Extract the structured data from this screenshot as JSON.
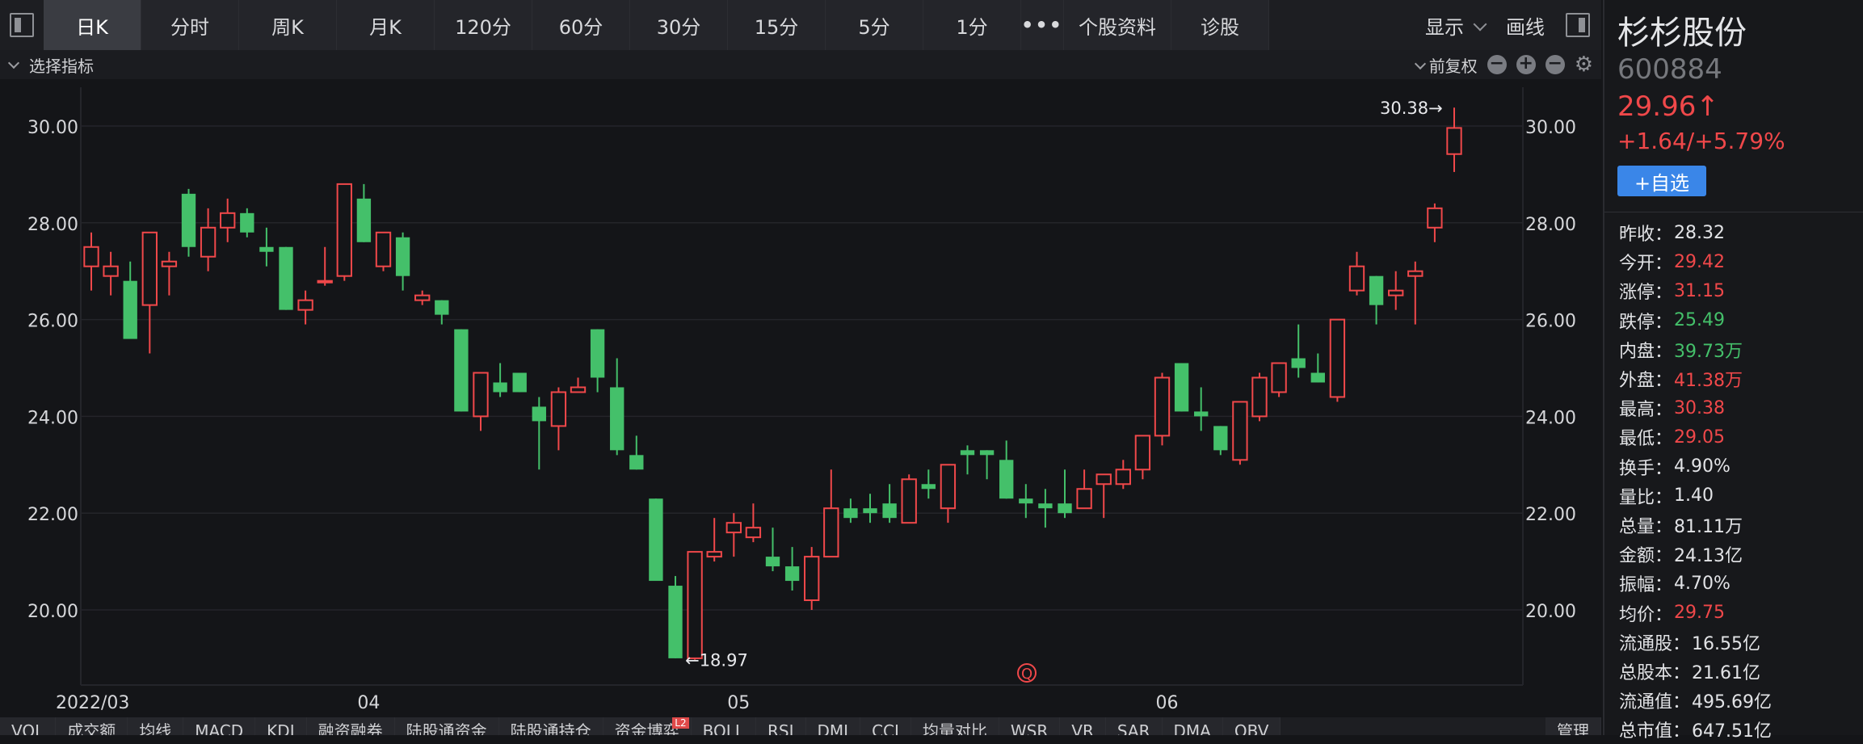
{
  "toolbar": {
    "tabs": [
      "日K",
      "分时",
      "周K",
      "月K",
      "120分",
      "60分",
      "30分",
      "15分",
      "5分",
      "1分",
      "•••",
      "个股资料",
      "诊股"
    ],
    "display_label": "显示",
    "draw_label": "画线"
  },
  "subbar": {
    "indicator_label": "选择指标",
    "adjust_label": "前复权"
  },
  "stock": {
    "name": "杉杉股份",
    "code": "600884",
    "price": "29.96↑",
    "change": "+1.64/+5.79%",
    "add_label": "+自选"
  },
  "stats": [
    {
      "k": "昨收：",
      "v": "28.32",
      "color": "#e2e3e6"
    },
    {
      "k": "今开：",
      "v": "29.42",
      "color": "#f0484a"
    },
    {
      "k": "涨停：",
      "v": "31.15",
      "color": "#f0484a"
    },
    {
      "k": "跌停：",
      "v": "25.49",
      "color": "#44c06a"
    },
    {
      "k": "内盘：",
      "v": "39.73万",
      "color": "#44c06a"
    },
    {
      "k": "外盘：",
      "v": "41.38万",
      "color": "#f0484a"
    },
    {
      "k": "最高：",
      "v": "30.38",
      "color": "#f0484a"
    },
    {
      "k": "最低：",
      "v": "29.05",
      "color": "#f0484a"
    },
    {
      "k": "换手：",
      "v": "4.90%",
      "color": "#e2e3e6"
    },
    {
      "k": "量比：",
      "v": "1.40",
      "color": "#e2e3e6"
    },
    {
      "k": "总量：",
      "v": "81.11万",
      "color": "#e2e3e6"
    },
    {
      "k": "金额：",
      "v": "24.13亿",
      "color": "#e2e3e6"
    },
    {
      "k": "振幅：",
      "v": "4.70%",
      "color": "#e2e3e6"
    },
    {
      "k": "均价：",
      "v": "29.75",
      "color": "#f0484a"
    },
    {
      "k": "流通股：",
      "v": "16.55亿",
      "color": "#e2e3e6"
    },
    {
      "k": "总股本：",
      "v": "21.61亿",
      "color": "#e2e3e6"
    },
    {
      "k": "流通值：",
      "v": "495.69亿",
      "color": "#e2e3e6"
    },
    {
      "k": "总市值：",
      "v": "647.51亿",
      "color": "#e2e3e6"
    }
  ],
  "bottom_tabs": [
    "VOL",
    "成交额",
    "均线",
    "MACD",
    "KDJ",
    "融资融券",
    "陆股通资金",
    "陆股通持仓",
    "资金博弈",
    "BOLL",
    "RSI",
    "DMI",
    "CCI",
    "均量对比",
    "WSR",
    "VR",
    "SAR",
    "DMA",
    "OBV",
    "管理"
  ],
  "bottom_badge": "L2",
  "colors": {
    "up": "#f0484a",
    "down": "#44c06a",
    "grid": "#24252a",
    "axis_text": "#d6d7da"
  },
  "chart_data": {
    "type": "candlestick",
    "x_labels": [
      "2022/03",
      "04",
      "05",
      "06"
    ],
    "y_ticks": [
      "30.00",
      "28.00",
      "26.00",
      "24.00",
      "22.00",
      "20.00"
    ],
    "ylim": [
      18.4,
      31.3
    ],
    "annotations": [
      {
        "text": "30.38→",
        "value": 30.38
      },
      {
        "text": "←18.97",
        "value": 18.97
      }
    ],
    "marker": "Q",
    "candles": [
      {
        "o": 27.1,
        "h": 27.8,
        "l": 26.6,
        "c": 27.5
      },
      {
        "o": 26.9,
        "h": 27.4,
        "l": 26.5,
        "c": 27.1
      },
      {
        "o": 26.8,
        "h": 27.2,
        "l": 25.6,
        "c": 25.6
      },
      {
        "o": 26.3,
        "h": 27.8,
        "l": 25.3,
        "c": 27.8
      },
      {
        "o": 27.1,
        "h": 27.4,
        "l": 26.5,
        "c": 27.2
      },
      {
        "o": 28.6,
        "h": 28.7,
        "l": 27.3,
        "c": 27.5
      },
      {
        "o": 27.3,
        "h": 28.3,
        "l": 27.0,
        "c": 27.9
      },
      {
        "o": 27.9,
        "h": 28.5,
        "l": 27.6,
        "c": 28.2
      },
      {
        "o": 28.2,
        "h": 28.3,
        "l": 27.7,
        "c": 27.8
      },
      {
        "o": 27.5,
        "h": 27.9,
        "l": 27.1,
        "c": 27.4
      },
      {
        "o": 27.5,
        "h": 27.5,
        "l": 26.2,
        "c": 26.2
      },
      {
        "o": 26.2,
        "h": 26.6,
        "l": 25.9,
        "c": 26.4
      },
      {
        "o": 26.8,
        "h": 27.5,
        "l": 26.7,
        "c": 26.8
      },
      {
        "o": 26.9,
        "h": 28.8,
        "l": 26.8,
        "c": 28.8
      },
      {
        "o": 28.5,
        "h": 28.8,
        "l": 27.6,
        "c": 27.6
      },
      {
        "o": 27.1,
        "h": 27.8,
        "l": 27.0,
        "c": 27.8
      },
      {
        "o": 27.7,
        "h": 27.8,
        "l": 26.6,
        "c": 26.9
      },
      {
        "o": 26.4,
        "h": 26.6,
        "l": 26.3,
        "c": 26.5
      },
      {
        "o": 26.4,
        "h": 26.4,
        "l": 25.9,
        "c": 26.1
      },
      {
        "o": 25.8,
        "h": 25.8,
        "l": 24.1,
        "c": 24.1
      },
      {
        "o": 24.0,
        "h": 24.9,
        "l": 23.7,
        "c": 24.9
      },
      {
        "o": 24.7,
        "h": 25.1,
        "l": 24.4,
        "c": 24.5
      },
      {
        "o": 24.9,
        "h": 24.9,
        "l": 24.5,
        "c": 24.5
      },
      {
        "o": 24.2,
        "h": 24.4,
        "l": 22.9,
        "c": 23.9
      },
      {
        "o": 23.8,
        "h": 24.6,
        "l": 23.3,
        "c": 24.5
      },
      {
        "o": 24.5,
        "h": 24.8,
        "l": 24.5,
        "c": 24.6
      },
      {
        "o": 25.8,
        "h": 25.8,
        "l": 24.5,
        "c": 24.8
      },
      {
        "o": 24.6,
        "h": 25.2,
        "l": 23.2,
        "c": 23.3
      },
      {
        "o": 23.2,
        "h": 23.6,
        "l": 22.9,
        "c": 22.9
      },
      {
        "o": 22.3,
        "h": 22.3,
        "l": 20.6,
        "c": 20.6
      },
      {
        "o": 20.5,
        "h": 20.7,
        "l": 19.0,
        "c": 19.0
      },
      {
        "o": 19.0,
        "h": 21.2,
        "l": 18.97,
        "c": 21.2
      },
      {
        "o": 21.1,
        "h": 21.9,
        "l": 21.0,
        "c": 21.2
      },
      {
        "o": 21.6,
        "h": 22.0,
        "l": 21.1,
        "c": 21.8
      },
      {
        "o": 21.5,
        "h": 22.2,
        "l": 21.4,
        "c": 21.7
      },
      {
        "o": 21.1,
        "h": 21.7,
        "l": 20.8,
        "c": 20.9
      },
      {
        "o": 20.9,
        "h": 21.3,
        "l": 20.4,
        "c": 20.6
      },
      {
        "o": 20.2,
        "h": 21.3,
        "l": 20.0,
        "c": 21.1
      },
      {
        "o": 21.1,
        "h": 22.9,
        "l": 21.1,
        "c": 22.1
      },
      {
        "o": 22.1,
        "h": 22.3,
        "l": 21.8,
        "c": 21.9
      },
      {
        "o": 22.1,
        "h": 22.4,
        "l": 21.8,
        "c": 22.0
      },
      {
        "o": 22.2,
        "h": 22.6,
        "l": 21.8,
        "c": 21.9
      },
      {
        "o": 21.8,
        "h": 22.8,
        "l": 21.8,
        "c": 22.7
      },
      {
        "o": 22.6,
        "h": 22.9,
        "l": 22.3,
        "c": 22.5
      },
      {
        "o": 22.1,
        "h": 23.0,
        "l": 21.8,
        "c": 23.0
      },
      {
        "o": 23.3,
        "h": 23.4,
        "l": 22.8,
        "c": 23.2
      },
      {
        "o": 23.3,
        "h": 23.3,
        "l": 22.7,
        "c": 23.2
      },
      {
        "o": 23.1,
        "h": 23.5,
        "l": 22.3,
        "c": 22.3
      },
      {
        "o": 22.3,
        "h": 22.6,
        "l": 21.9,
        "c": 22.2
      },
      {
        "o": 22.2,
        "h": 22.5,
        "l": 21.7,
        "c": 22.1
      },
      {
        "o": 22.2,
        "h": 22.9,
        "l": 21.9,
        "c": 22.0
      },
      {
        "o": 22.1,
        "h": 22.9,
        "l": 22.1,
        "c": 22.5
      },
      {
        "o": 22.6,
        "h": 22.7,
        "l": 21.9,
        "c": 22.8
      },
      {
        "o": 22.6,
        "h": 23.1,
        "l": 22.5,
        "c": 22.9
      },
      {
        "o": 22.9,
        "h": 23.6,
        "l": 22.7,
        "c": 23.6
      },
      {
        "o": 23.6,
        "h": 24.9,
        "l": 23.4,
        "c": 24.8
      },
      {
        "o": 25.1,
        "h": 25.1,
        "l": 24.1,
        "c": 24.1
      },
      {
        "o": 24.1,
        "h": 24.6,
        "l": 23.7,
        "c": 24.0
      },
      {
        "o": 23.8,
        "h": 23.8,
        "l": 23.2,
        "c": 23.3
      },
      {
        "o": 23.1,
        "h": 24.3,
        "l": 23.0,
        "c": 24.3
      },
      {
        "o": 24.0,
        "h": 24.9,
        "l": 23.9,
        "c": 24.8
      },
      {
        "o": 24.5,
        "h": 25.1,
        "l": 24.4,
        "c": 25.1
      },
      {
        "o": 25.2,
        "h": 25.9,
        "l": 24.8,
        "c": 25.0
      },
      {
        "o": 24.9,
        "h": 25.3,
        "l": 24.7,
        "c": 24.7
      },
      {
        "o": 24.4,
        "h": 26.0,
        "l": 24.3,
        "c": 26.0
      },
      {
        "o": 26.6,
        "h": 27.4,
        "l": 26.5,
        "c": 27.1
      },
      {
        "o": 26.9,
        "h": 26.9,
        "l": 25.9,
        "c": 26.3
      },
      {
        "o": 26.5,
        "h": 27.0,
        "l": 26.2,
        "c": 26.6
      },
      {
        "o": 26.9,
        "h": 27.2,
        "l": 25.9,
        "c": 27.0
      },
      {
        "o": 27.9,
        "h": 28.4,
        "l": 27.6,
        "c": 28.3
      },
      {
        "o": 29.42,
        "h": 30.38,
        "l": 29.05,
        "c": 29.96
      }
    ]
  }
}
